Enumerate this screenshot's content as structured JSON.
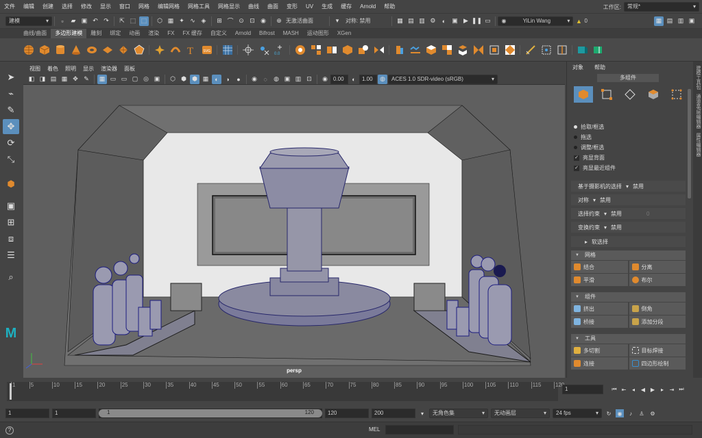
{
  "menu": [
    "文件",
    "编辑",
    "创建",
    "选择",
    "修改",
    "显示",
    "窗口",
    "网格",
    "编辑网格",
    "网格工具",
    "网格显示",
    "曲线",
    "曲面",
    "变形",
    "UV",
    "生成",
    "缓存",
    "Arnold",
    "帮助"
  ],
  "workspace": {
    "label": "工作区:",
    "value": "常规*"
  },
  "status": {
    "mode": "建模",
    "no_live": "无激活曲面",
    "symmetry": "对称: 禁用",
    "user": "YiLin Wang",
    "notif": "0"
  },
  "shelf_tabs": [
    "曲线/曲面",
    "多边形建模",
    "雕刻",
    "绑定",
    "动画",
    "渲染",
    "FX",
    "FX 缓存",
    "自定义",
    "Arnold",
    "Bifrost",
    "MASH",
    "运动图形",
    "XGen"
  ],
  "shelf_active": 1,
  "viewport": {
    "menu": [
      "视图",
      "着色",
      "照明",
      "显示",
      "渲染器",
      "面板"
    ],
    "exposure": "0.00",
    "gamma": "1.00",
    "colorspace": "ACES 1.0 SDR-video (sRGB)",
    "camera": "persp"
  },
  "panel": {
    "tabs": [
      "对象",
      "帮助"
    ],
    "header": "多组件",
    "pick": [
      {
        "label": "拾取/框选",
        "on": true
      },
      {
        "label": "拖选",
        "on": false
      },
      {
        "label": "调整/框选",
        "on": false
      }
    ],
    "checks": [
      "亮显背面",
      "亮显最近组件"
    ],
    "camera_based": {
      "label": "基于摄影机的选择",
      "value": "禁用"
    },
    "symmetry": {
      "label": "对称",
      "value": "禁用"
    },
    "select_constraint": {
      "label": "选择约束",
      "value": "禁用",
      "num": "0"
    },
    "transform_constraint": {
      "label": "变换约束",
      "value": "禁用"
    },
    "soft_select": "软选择",
    "sections": [
      {
        "title": "网格",
        "buttons": [
          [
            "结合",
            "分离"
          ],
          [
            "平滑",
            "布尔"
          ]
        ],
        "colors": [
          [
            "#e08a2e",
            "#e08a2e"
          ],
          [
            "#e08a2e",
            "#e08a2e"
          ]
        ]
      },
      {
        "title": "组件",
        "buttons": [
          [
            "挤出",
            "倒角"
          ],
          [
            "桥接",
            "添加分段"
          ]
        ],
        "colors": [
          [
            "#7fb4e0",
            "#c8a34a"
          ],
          [
            "#7fb4e0",
            "#c8a34a"
          ]
        ]
      },
      {
        "title": "工具",
        "buttons": [
          [
            "多切割",
            "目标焊接"
          ],
          [
            "连接",
            "四边形绘制"
          ]
        ],
        "colors": [
          [
            "#e0b040",
            "#3a8fd0"
          ],
          [
            "#e08a2e",
            "#3a8fd0"
          ]
        ]
      }
    ]
  },
  "side_tabs": [
    "建模工具包",
    "通道盒/层编辑器",
    "属性编辑器"
  ],
  "timeline": {
    "ticks": [
      "1",
      "5",
      "10",
      "15",
      "20",
      "25",
      "30",
      "35",
      "40",
      "45",
      "50",
      "55",
      "60",
      "65",
      "70",
      "75",
      "80",
      "85",
      "90",
      "95",
      "100",
      "105",
      "110",
      "115",
      "120"
    ],
    "current": "1"
  },
  "range": {
    "start": "1",
    "start2": "1",
    "range_start": "1",
    "range_end": "120",
    "end": "120",
    "end2": "200",
    "char_set": "无角色集",
    "anim_layer": "无动画层",
    "fps": "24 fps"
  },
  "cmd": {
    "label": "MEL"
  },
  "colors": {
    "accent": "#5b8fbd",
    "orange": "#e08a2e"
  }
}
